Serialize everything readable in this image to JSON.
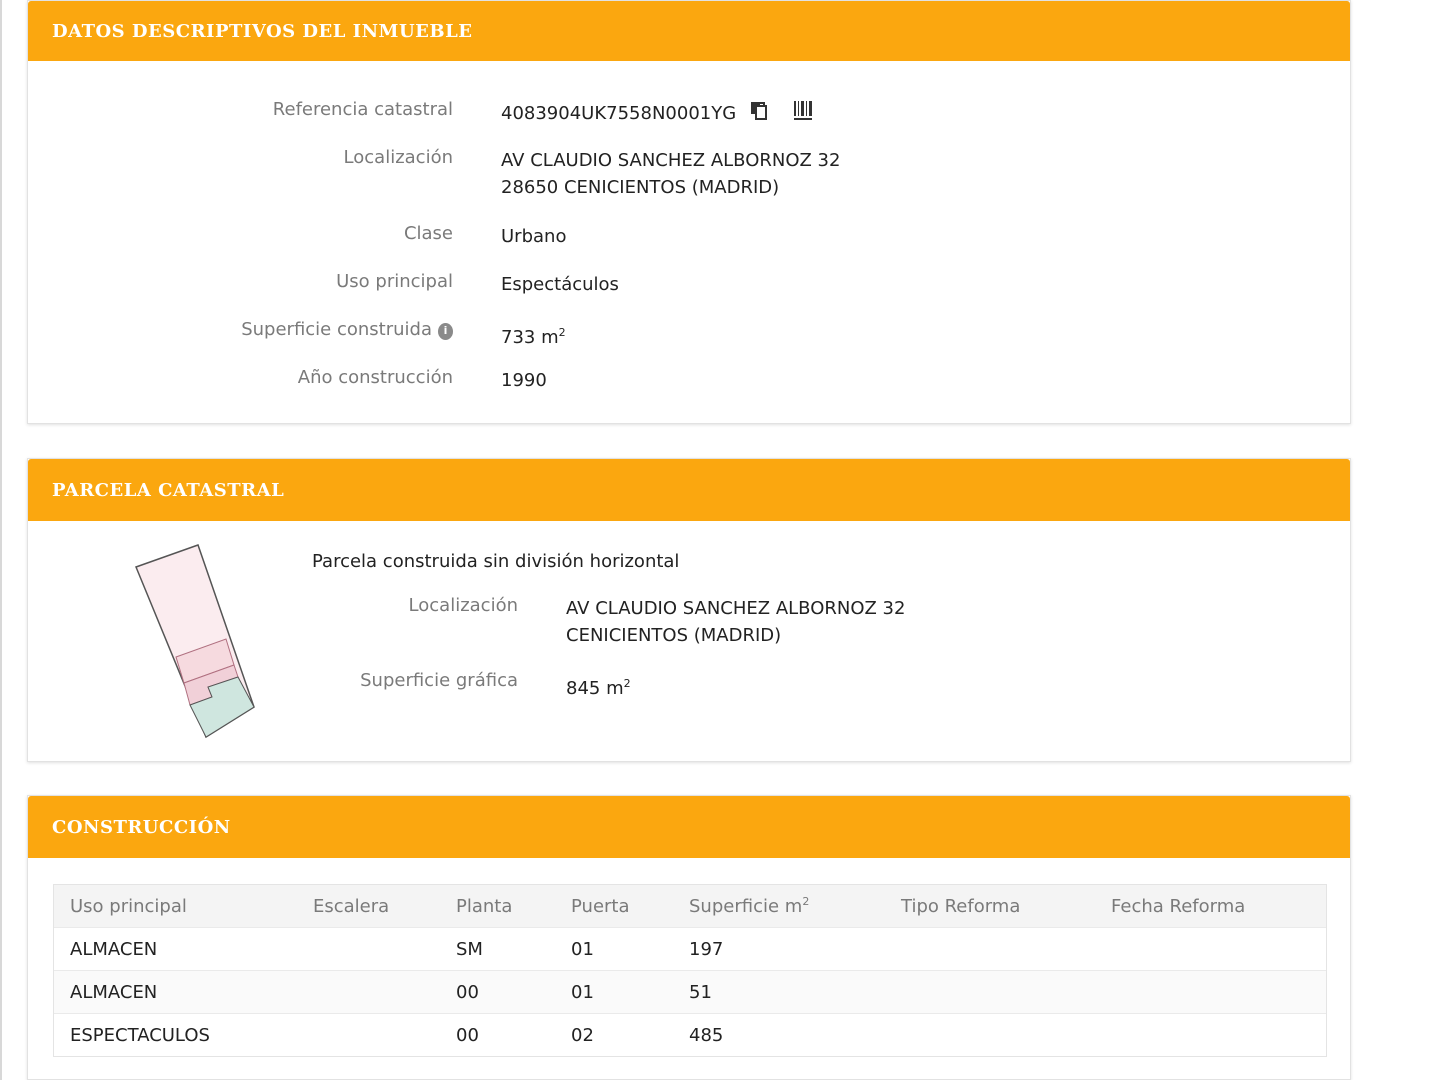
{
  "datos": {
    "header": "DATOS DESCRIPTIVOS DEL INMUEBLE",
    "referencia_label": "Referencia catastral",
    "referencia_value": "4083904UK7558N0001YG",
    "localizacion_label": "Localización",
    "localizacion_line1": "AV CLAUDIO SANCHEZ ALBORNOZ 32",
    "localizacion_line2": "28650 CENICIENTOS (MADRID)",
    "clase_label": "Clase",
    "clase_value": "Urbano",
    "uso_label": "Uso principal",
    "uso_value": "Espectáculos",
    "superficie_label": "Superficie construida",
    "superficie_value": "733 m",
    "superficie_unit_exp": "2",
    "anio_label": "Año construcción",
    "anio_value": "1990",
    "icons": [
      "copy-icon",
      "barcode-icon",
      "info-icon"
    ]
  },
  "parcela": {
    "header": "PARCELA CATASTRAL",
    "title": "Parcela construida sin división horizontal",
    "localizacion_label": "Localización",
    "localizacion_line1": "AV CLAUDIO SANCHEZ ALBORNOZ 32",
    "localizacion_line2": "CENICIENTOS (MADRID)",
    "superficie_label": "Superficie gráfica",
    "superficie_value": "845 m",
    "superficie_unit_exp": "2"
  },
  "construccion": {
    "header": "CONSTRUCCIÓN",
    "columns": [
      "Uso principal",
      "Escalera",
      "Planta",
      "Puerta",
      "Superficie m",
      "Tipo Reforma",
      "Fecha Reforma"
    ],
    "superficie_exp": "2",
    "rows": [
      [
        "ALMACEN",
        "",
        "SM",
        "01",
        "197",
        "",
        ""
      ],
      [
        "ALMACEN",
        "",
        "00",
        "01",
        "51",
        "",
        ""
      ],
      [
        "ESPECTACULOS",
        "",
        "00",
        "02",
        "485",
        "",
        ""
      ]
    ]
  },
  "colors": {
    "header_bg": "#fba70f",
    "header_text": "#ffffff",
    "label": "#7a7a7a"
  }
}
